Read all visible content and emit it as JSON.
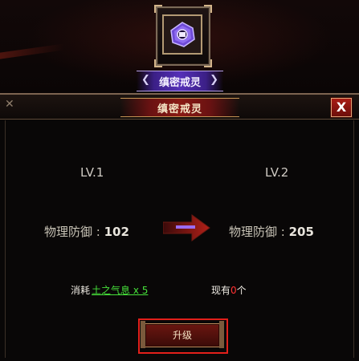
{
  "item": {
    "name": "缜密戒灵",
    "icon": "purple-gem-icon"
  },
  "dialog": {
    "title": "缜密戒灵",
    "close_label": "X"
  },
  "levels": {
    "current": "LV.1",
    "next": "LV.2"
  },
  "stats": {
    "label": "物理防御",
    "separator": " : ",
    "current_value": "102",
    "next_value": "205"
  },
  "cost": {
    "prefix": "消耗",
    "item": "土之气息 x 5"
  },
  "owned": {
    "prefix": "现有",
    "count": "0",
    "suffix": "个"
  },
  "upgrade": {
    "label": "升级"
  },
  "colors": {
    "cost_item": "#46e03a",
    "owned_count": "#ff3232",
    "highlight": "#e21f1a",
    "badge": "#5530b8"
  }
}
